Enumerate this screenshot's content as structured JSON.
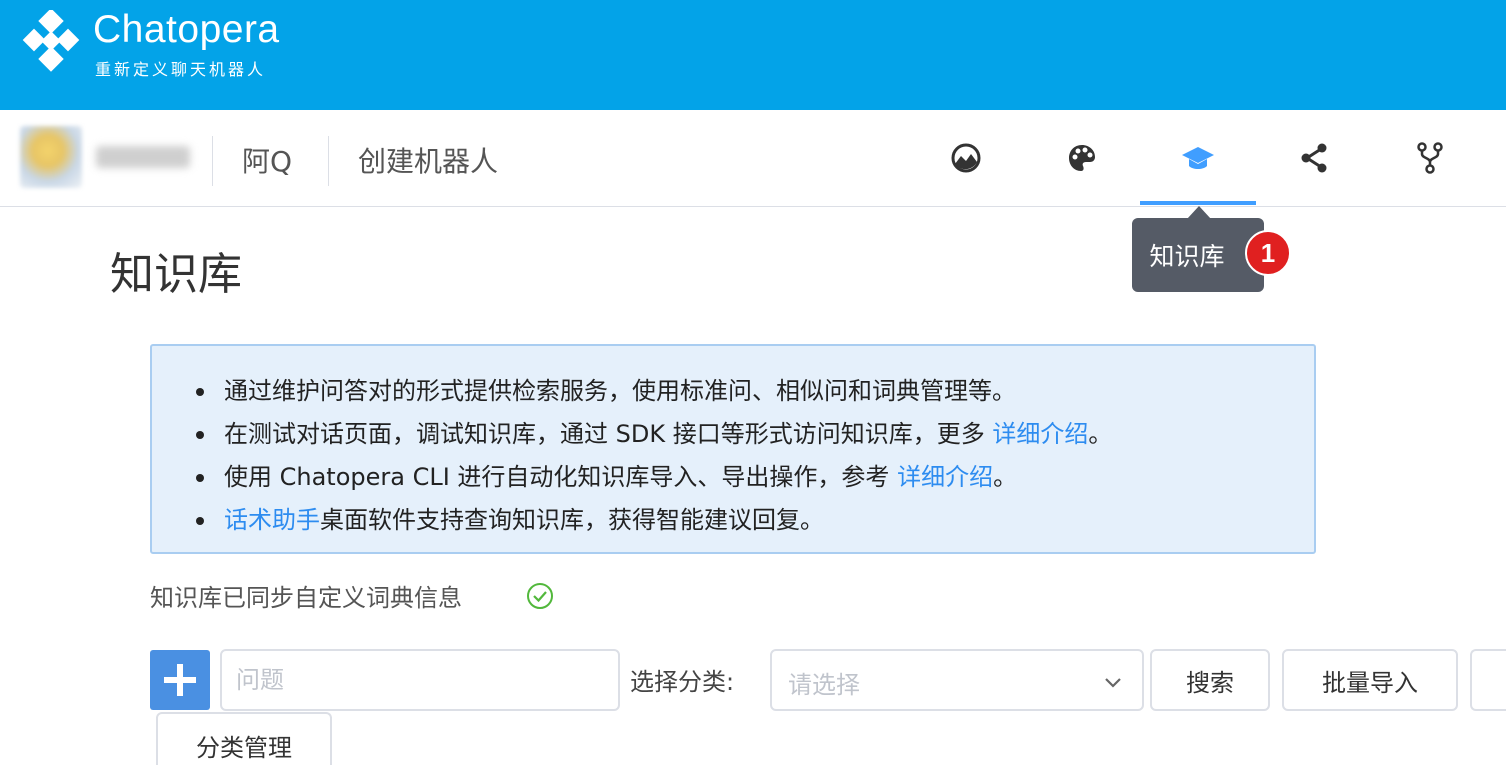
{
  "brand": {
    "name": "Chatopera",
    "tagline": "重新定义聊天机器人",
    "color": "#03a3e8"
  },
  "subnav": {
    "bot_name": "阿Q",
    "create_bot": "创建机器人",
    "icons": [
      "dashboard-icon",
      "palette-icon",
      "graduation-cap-icon",
      "share-icon",
      "fork-icon"
    ],
    "active_icon": "graduation-cap-icon",
    "accent_color": "#409eff"
  },
  "tooltip": {
    "label": "知识库",
    "badge": "1"
  },
  "page": {
    "title": "知识库"
  },
  "info": {
    "item1": "通过维护问答对的形式提供检索服务，使用标准问、相似问和词典管理等。",
    "item2_text": "在测试对话页面，调试知识库，通过 SDK 接口等形式访问知识库，更多 ",
    "item2_link": "详细介绍",
    "item2_end": "。",
    "item3_text": "使用 Chatopera CLI 进行自动化知识库导入、导出操作，参考 ",
    "item3_link": "详细介绍",
    "item3_end": "。",
    "item4_link": "话术助手",
    "item4_text": "桌面软件支持查询知识库，获得智能建议回复。"
  },
  "sync_status": "知识库已同步自定义词典信息",
  "toolbar": {
    "question_placeholder": "问题",
    "category_label": "选择分类:",
    "category_placeholder": "请选择",
    "search_label": "搜索",
    "import_label": "批量导入",
    "category_manage_label": "分类管理"
  }
}
